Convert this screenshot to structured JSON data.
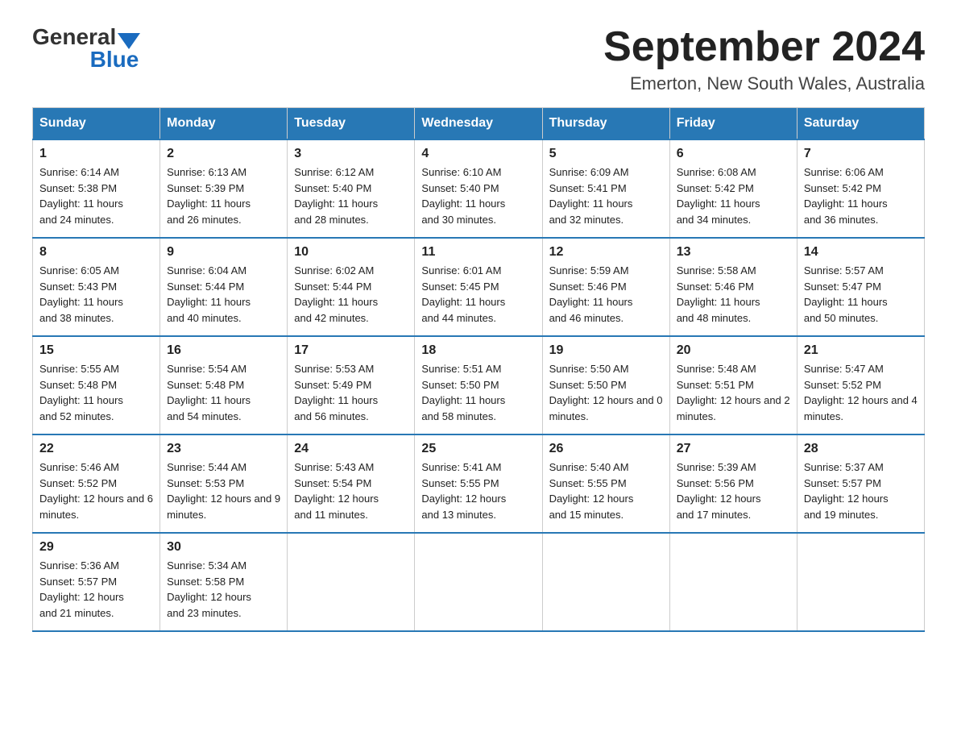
{
  "logo": {
    "general": "General",
    "blue": "Blue"
  },
  "title": "September 2024",
  "location": "Emerton, New South Wales, Australia",
  "weekdays": [
    "Sunday",
    "Monday",
    "Tuesday",
    "Wednesday",
    "Thursday",
    "Friday",
    "Saturday"
  ],
  "weeks": [
    [
      {
        "day": "1",
        "sunrise": "6:14 AM",
        "sunset": "5:38 PM",
        "daylight": "11 hours and 24 minutes."
      },
      {
        "day": "2",
        "sunrise": "6:13 AM",
        "sunset": "5:39 PM",
        "daylight": "11 hours and 26 minutes."
      },
      {
        "day": "3",
        "sunrise": "6:12 AM",
        "sunset": "5:40 PM",
        "daylight": "11 hours and 28 minutes."
      },
      {
        "day": "4",
        "sunrise": "6:10 AM",
        "sunset": "5:40 PM",
        "daylight": "11 hours and 30 minutes."
      },
      {
        "day": "5",
        "sunrise": "6:09 AM",
        "sunset": "5:41 PM",
        "daylight": "11 hours and 32 minutes."
      },
      {
        "day": "6",
        "sunrise": "6:08 AM",
        "sunset": "5:42 PM",
        "daylight": "11 hours and 34 minutes."
      },
      {
        "day": "7",
        "sunrise": "6:06 AM",
        "sunset": "5:42 PM",
        "daylight": "11 hours and 36 minutes."
      }
    ],
    [
      {
        "day": "8",
        "sunrise": "6:05 AM",
        "sunset": "5:43 PM",
        "daylight": "11 hours and 38 minutes."
      },
      {
        "day": "9",
        "sunrise": "6:04 AM",
        "sunset": "5:44 PM",
        "daylight": "11 hours and 40 minutes."
      },
      {
        "day": "10",
        "sunrise": "6:02 AM",
        "sunset": "5:44 PM",
        "daylight": "11 hours and 42 minutes."
      },
      {
        "day": "11",
        "sunrise": "6:01 AM",
        "sunset": "5:45 PM",
        "daylight": "11 hours and 44 minutes."
      },
      {
        "day": "12",
        "sunrise": "5:59 AM",
        "sunset": "5:46 PM",
        "daylight": "11 hours and 46 minutes."
      },
      {
        "day": "13",
        "sunrise": "5:58 AM",
        "sunset": "5:46 PM",
        "daylight": "11 hours and 48 minutes."
      },
      {
        "day": "14",
        "sunrise": "5:57 AM",
        "sunset": "5:47 PM",
        "daylight": "11 hours and 50 minutes."
      }
    ],
    [
      {
        "day": "15",
        "sunrise": "5:55 AM",
        "sunset": "5:48 PM",
        "daylight": "11 hours and 52 minutes."
      },
      {
        "day": "16",
        "sunrise": "5:54 AM",
        "sunset": "5:48 PM",
        "daylight": "11 hours and 54 minutes."
      },
      {
        "day": "17",
        "sunrise": "5:53 AM",
        "sunset": "5:49 PM",
        "daylight": "11 hours and 56 minutes."
      },
      {
        "day": "18",
        "sunrise": "5:51 AM",
        "sunset": "5:50 PM",
        "daylight": "11 hours and 58 minutes."
      },
      {
        "day": "19",
        "sunrise": "5:50 AM",
        "sunset": "5:50 PM",
        "daylight": "12 hours and 0 minutes."
      },
      {
        "day": "20",
        "sunrise": "5:48 AM",
        "sunset": "5:51 PM",
        "daylight": "12 hours and 2 minutes."
      },
      {
        "day": "21",
        "sunrise": "5:47 AM",
        "sunset": "5:52 PM",
        "daylight": "12 hours and 4 minutes."
      }
    ],
    [
      {
        "day": "22",
        "sunrise": "5:46 AM",
        "sunset": "5:52 PM",
        "daylight": "12 hours and 6 minutes."
      },
      {
        "day": "23",
        "sunrise": "5:44 AM",
        "sunset": "5:53 PM",
        "daylight": "12 hours and 9 minutes."
      },
      {
        "day": "24",
        "sunrise": "5:43 AM",
        "sunset": "5:54 PM",
        "daylight": "12 hours and 11 minutes."
      },
      {
        "day": "25",
        "sunrise": "5:41 AM",
        "sunset": "5:55 PM",
        "daylight": "12 hours and 13 minutes."
      },
      {
        "day": "26",
        "sunrise": "5:40 AM",
        "sunset": "5:55 PM",
        "daylight": "12 hours and 15 minutes."
      },
      {
        "day": "27",
        "sunrise": "5:39 AM",
        "sunset": "5:56 PM",
        "daylight": "12 hours and 17 minutes."
      },
      {
        "day": "28",
        "sunrise": "5:37 AM",
        "sunset": "5:57 PM",
        "daylight": "12 hours and 19 minutes."
      }
    ],
    [
      {
        "day": "29",
        "sunrise": "5:36 AM",
        "sunset": "5:57 PM",
        "daylight": "12 hours and 21 minutes."
      },
      {
        "day": "30",
        "sunrise": "5:34 AM",
        "sunset": "5:58 PM",
        "daylight": "12 hours and 23 minutes."
      },
      null,
      null,
      null,
      null,
      null
    ]
  ],
  "labels": {
    "sunrise": "Sunrise: ",
    "sunset": "Sunset: ",
    "daylight": "Daylight: "
  }
}
